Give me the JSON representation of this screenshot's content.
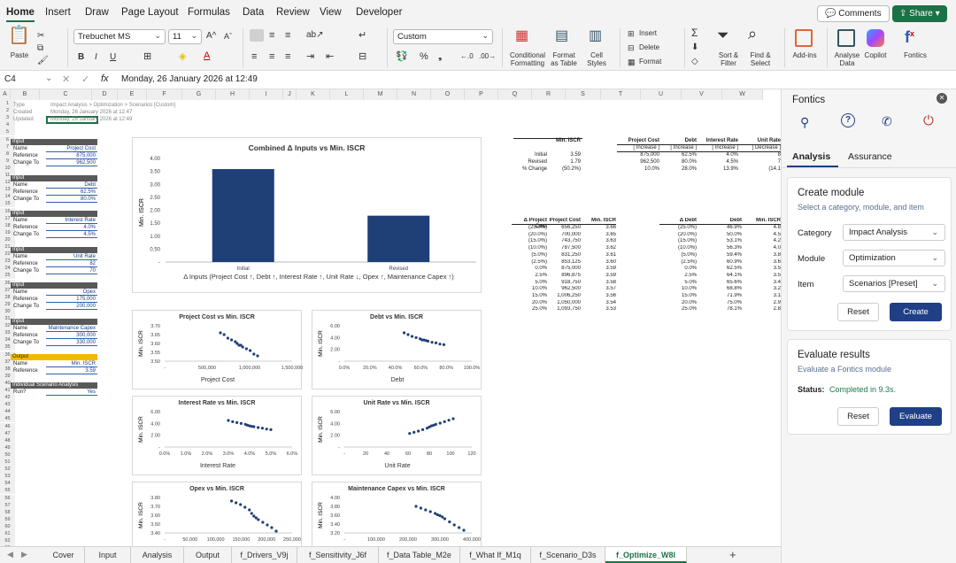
{
  "menu_tabs": [
    "Home",
    "Insert",
    "Draw",
    "Page Layout",
    "Formulas",
    "Data",
    "Review",
    "View",
    "Developer"
  ],
  "menu_active": "Home",
  "comments_label": "Comments",
  "share_label": "Share",
  "ribbon": {
    "paste": "Paste",
    "font_name": "Trebuchet MS",
    "font_size": "11",
    "number_format": "Custom",
    "bold": "B",
    "italic": "I",
    "underline": "U",
    "conditional_formatting": "Conditional Formatting",
    "format_as_table": "Format as Table",
    "cell_styles": "Cell Styles",
    "insert": "Insert",
    "delete": "Delete",
    "format": "Format",
    "sort_filter": "Sort & Filter",
    "find_select": "Find & Select",
    "add_ins": "Add-ins",
    "analyse_data": "Analyse Data",
    "copilot": "Copilot",
    "fontics": "Fontics"
  },
  "formula_bar": {
    "cell_ref": "C4",
    "fx": "fx",
    "value": "Monday, 26 January 2026 at 12:49"
  },
  "columns": [
    "A",
    "B",
    "C",
    "D",
    "E",
    "F",
    "G",
    "H",
    "I",
    "J",
    "K",
    "L",
    "M",
    "N",
    "O",
    "P",
    "Q",
    "R",
    "S",
    "T",
    "U",
    "V",
    "W"
  ],
  "row_numbers": [
    "1",
    "2",
    "3",
    "4",
    "5",
    "6",
    "7",
    "8",
    "9",
    "10",
    "11",
    "12",
    "13",
    "14",
    "15",
    "16",
    "17",
    "18",
    "19",
    "20",
    "21",
    "22",
    "23",
    "24",
    "25",
    "26",
    "27",
    "28",
    "29",
    "30",
    "31",
    "32",
    "33",
    "34",
    "35",
    "36",
    "37",
    "38",
    "39",
    "40",
    "41",
    "42",
    "43",
    "44",
    "45",
    "46",
    "47",
    "48",
    "49",
    "50",
    "51",
    "52",
    "53",
    "54",
    "55",
    "56",
    "57",
    "58",
    "59",
    "60",
    "61",
    "62",
    "63"
  ],
  "meta": {
    "type_label": "Type",
    "type_value": "Impact Analysis > Optimization > Scenarios [Custom]",
    "created_label": "Created",
    "created_value": "Monday, 26 January 2026 at 12:47",
    "updated_label": "Updated",
    "updated_value": "Monday, 26 January 2026 at 12:49"
  },
  "inputs": [
    {
      "header": "Input",
      "name": "Project Cost",
      "reference": "875,000",
      "change_to": "962,500"
    },
    {
      "header": "Input",
      "name": "Debt",
      "reference": "62.5%",
      "change_to": "80.0%"
    },
    {
      "header": "Input",
      "name": "Interest Rate",
      "reference": "4.0%",
      "change_to": "4.5%"
    },
    {
      "header": "Input",
      "name": "Unit Rate",
      "reference": "82",
      "change_to": "70"
    },
    {
      "header": "Input",
      "name": "Opex",
      "reference": "175,000",
      "change_to": "200,000"
    },
    {
      "header": "Input",
      "name": "Maintenance Capex",
      "reference": "300,000",
      "change_to": "330,000"
    }
  ],
  "row_labels": {
    "name": "Name",
    "reference": "Reference",
    "change_to": "Change To"
  },
  "output": {
    "header": "Output",
    "name_label": "Name",
    "name": "Min. ISCR",
    "reference_label": "Reference",
    "reference": "3.59"
  },
  "individual": {
    "header": "Individual Scenario Analysis",
    "run_label": "Run?",
    "run_value": "Yes"
  },
  "summary_table": {
    "header": "Min. ISCR",
    "rows": [
      [
        "Initial",
        "3.59"
      ],
      [
        "Revised",
        "1.79"
      ],
      [
        "% Change",
        "(50.2%)"
      ]
    ]
  },
  "changes_table": {
    "headers": [
      "Project Cost",
      "Debt",
      "Interest Rate",
      "Unit Rate"
    ],
    "subheaders": [
      "[ Increase ]",
      "[ Increase ]",
      "[ Increase ]",
      "[ Decrease ]"
    ],
    "rows": [
      [
        "875,000",
        "62.5%",
        "4.0%",
        "8"
      ],
      [
        "962,500",
        "80.0%",
        "4.5%",
        "7"
      ],
      [
        "10.0%",
        "28.0%",
        "13.9%",
        "(14.1"
      ]
    ]
  },
  "sens_project": {
    "headers": [
      "Δ Project Cost",
      "Project Cost",
      "Min. ISCR"
    ],
    "rows": [
      [
        "(25.0%)",
        "656,250",
        "3.66"
      ],
      [
        "(20.0%)",
        "700,000",
        "3.65"
      ],
      [
        "(15.0%)",
        "743,750",
        "3.63"
      ],
      [
        "(10.0%)",
        "787,500",
        "3.62"
      ],
      [
        "(5.0%)",
        "831,250",
        "3.61"
      ],
      [
        "(2.5%)",
        "853,125",
        "3.60"
      ],
      [
        "0.0%",
        "875,000",
        "3.59"
      ],
      [
        "2.5%",
        "896,875",
        "3.59"
      ],
      [
        "5.0%",
        "918,750",
        "3.58"
      ],
      [
        "10.0%",
        "962,500",
        "3.57"
      ],
      [
        "15.0%",
        "1,006,250",
        "3.56"
      ],
      [
        "20.0%",
        "1,050,000",
        "3.54"
      ],
      [
        "25.0%",
        "1,093,750",
        "3.53"
      ]
    ]
  },
  "sens_debt": {
    "headers": [
      "Δ Debt",
      "Debt",
      "Min. ISCR"
    ],
    "rows": [
      [
        "(25.0%)",
        "46.9%",
        "4.8"
      ],
      [
        "(20.0%)",
        "50.0%",
        "4.5"
      ],
      [
        "(15.0%)",
        "53.1%",
        "4.2"
      ],
      [
        "(10.0%)",
        "56.3%",
        "4.0"
      ],
      [
        "(5.0%)",
        "59.4%",
        "3.8"
      ],
      [
        "(2.5%)",
        "60.9%",
        "3.6"
      ],
      [
        "0.0%",
        "62.5%",
        "3.5"
      ],
      [
        "2.5%",
        "64.1%",
        "3.5"
      ],
      [
        "5.0%",
        "65.6%",
        "3.4"
      ],
      [
        "10.0%",
        "68.8%",
        "3.2"
      ],
      [
        "15.0%",
        "71.9%",
        "3.1"
      ],
      [
        "20.0%",
        "75.0%",
        "2.9"
      ],
      [
        "25.0%",
        "78.1%",
        "2.8"
      ]
    ]
  },
  "chart_data": [
    {
      "type": "bar",
      "title": "Combined Δ Inputs vs Min. ISCR",
      "categories": [
        "Initial",
        "Revised"
      ],
      "values": [
        3.59,
        1.79
      ],
      "xlabel": "Δ Inputs (Project Cost ↑, Debt ↑, Interest Rate ↑, Unit Rate ↓, Opex ↑, Maintenance Capex ↑)",
      "ylabel": "Min. ISCR",
      "ylim": [
        0,
        4
      ],
      "yticks": [
        "4.00",
        "3.50",
        "3.00",
        "2.50",
        "2.00",
        "1.50",
        "1.00",
        "0.50",
        "-"
      ],
      "color": "#1f3f77"
    },
    {
      "type": "scatter",
      "title": "Project Cost vs Min. ISCR",
      "xlabel": "Project Cost",
      "ylabel": "Min. ISCR",
      "xticks": [
        "-",
        "500,000",
        "1,000,000",
        "1,500,000"
      ],
      "yticks": [
        "3.70",
        "3.65",
        "3.60",
        "3.55",
        "3.50"
      ],
      "x": [
        656250,
        700000,
        743750,
        787500,
        831250,
        853125,
        875000,
        896875,
        918750,
        962500,
        1006250,
        1050000,
        1093750
      ],
      "y": [
        3.66,
        3.65,
        3.63,
        3.62,
        3.61,
        3.6,
        3.59,
        3.59,
        3.58,
        3.57,
        3.56,
        3.54,
        3.53
      ],
      "xlim": [
        0,
        1500000
      ],
      "ylim": [
        3.5,
        3.7
      ]
    },
    {
      "type": "scatter",
      "title": "Debt vs Min. ISCR",
      "xlabel": "Debt",
      "ylabel": "Min. ISCR",
      "xticks": [
        "0.0%",
        "20.0%",
        "40.0%",
        "60.0%",
        "80.0%",
        "100.0%"
      ],
      "yticks": [
        "6.00",
        "4.00",
        "2.00",
        "-"
      ],
      "x": [
        46.9,
        50.0,
        53.1,
        56.3,
        59.4,
        60.9,
        62.5,
        64.1,
        65.6,
        68.8,
        71.9,
        75.0,
        78.1
      ],
      "y": [
        4.8,
        4.5,
        4.2,
        4.0,
        3.8,
        3.6,
        3.59,
        3.5,
        3.4,
        3.2,
        3.1,
        2.9,
        2.8
      ],
      "xlim": [
        0,
        100
      ],
      "ylim": [
        0,
        6
      ]
    },
    {
      "type": "scatter",
      "title": "Interest Rate vs Min. ISCR",
      "xlabel": "Interest Rate",
      "ylabel": "Min. ISCR",
      "xticks": [
        "0.0%",
        "1.0%",
        "2.0%",
        "3.0%",
        "4.0%",
        "5.0%",
        "6.0%"
      ],
      "yticks": [
        "6.00",
        "4.00",
        "2.00",
        "-"
      ],
      "x": [
        3.0,
        3.2,
        3.4,
        3.6,
        3.8,
        3.9,
        4.0,
        4.1,
        4.2,
        4.4,
        4.6,
        4.8,
        5.0
      ],
      "y": [
        4.5,
        4.3,
        4.15,
        4.0,
        3.85,
        3.7,
        3.59,
        3.5,
        3.45,
        3.3,
        3.2,
        3.05,
        2.95
      ],
      "xlim": [
        0,
        6
      ],
      "ylim": [
        0,
        6
      ]
    },
    {
      "type": "scatter",
      "title": "Unit Rate vs Min. ISCR",
      "xlabel": "Unit Rate",
      "ylabel": "Min. ISCR",
      "xticks": [
        "-",
        "20",
        "40",
        "60",
        "80",
        "100",
        "120"
      ],
      "yticks": [
        "6.00",
        "4.00",
        "2.00",
        "-"
      ],
      "x": [
        61.5,
        65.6,
        69.7,
        73.8,
        77.9,
        80.0,
        82.0,
        84.1,
        86.1,
        90.2,
        94.3,
        98.4,
        102.5
      ],
      "y": [
        2.3,
        2.5,
        2.7,
        2.95,
        3.2,
        3.4,
        3.59,
        3.7,
        3.85,
        4.05,
        4.3,
        4.55,
        4.8
      ],
      "xlim": [
        0,
        120
      ],
      "ylim": [
        0,
        6
      ]
    },
    {
      "type": "scatter",
      "title": "Opex vs Min. ISCR",
      "xlabel": "",
      "ylabel": "Min. ISCR",
      "xticks": [
        "-",
        "50,000",
        "100,000",
        "150,000",
        "200,000",
        "250,000"
      ],
      "yticks": [
        "3.80",
        "3.70",
        "3.60",
        "3.50",
        "3.40"
      ],
      "x": [
        131250,
        140000,
        148750,
        157500,
        166250,
        170625,
        175000,
        179375,
        183750,
        192500,
        201250,
        210000,
        218750
      ],
      "y": [
        3.76,
        3.74,
        3.72,
        3.69,
        3.66,
        3.62,
        3.59,
        3.57,
        3.55,
        3.52,
        3.49,
        3.46,
        3.42
      ],
      "xlim": [
        0,
        250000
      ],
      "ylim": [
        3.4,
        3.8
      ]
    },
    {
      "type": "scatter",
      "title": "Maintenance Capex vs Min. ISCR",
      "xlabel": "",
      "ylabel": "Min. ISCR",
      "xticks": [
        "-",
        "100,000",
        "200,000",
        "300,000",
        "400,000"
      ],
      "yticks": [
        "4.00",
        "3.80",
        "3.60",
        "3.40",
        "3.20"
      ],
      "x": [
        225000,
        240000,
        255000,
        270000,
        285000,
        292500,
        300000,
        307500,
        315000,
        330000,
        345000,
        360000,
        375000
      ],
      "y": [
        3.8,
        3.76,
        3.72,
        3.68,
        3.64,
        3.61,
        3.59,
        3.56,
        3.52,
        3.45,
        3.38,
        3.32,
        3.26
      ],
      "xlim": [
        0,
        400000
      ],
      "ylim": [
        3.2,
        4.0
      ]
    }
  ],
  "sheet_tabs": [
    "Cover",
    "Input",
    "Analysis",
    "Output",
    "f_Drivers_V9j",
    "f_Sensitivity_J6f",
    "f_Data Table_M2e",
    "f_What If_M1q",
    "f_Scenario_D3s",
    "f_Optimize_W8l"
  ],
  "active_sheet": "f_Optimize_W8l",
  "panel": {
    "title": "Fontics",
    "tabs": [
      "Analysis",
      "Assurance"
    ],
    "create": {
      "title": "Create module",
      "subtitle": "Select a category, module, and item",
      "category_label": "Category",
      "category_value": "Impact Analysis",
      "module_label": "Module",
      "module_value": "Optimization",
      "item_label": "Item",
      "item_value": "Scenarios [Preset]",
      "reset": "Reset",
      "create": "Create"
    },
    "evaluate": {
      "title": "Evaluate results",
      "subtitle": "Evaluate a Fontics module",
      "status_label": "Status:",
      "status_value": "Completed in 9.3s.",
      "reset": "Reset",
      "evaluate": "Evaluate"
    }
  }
}
